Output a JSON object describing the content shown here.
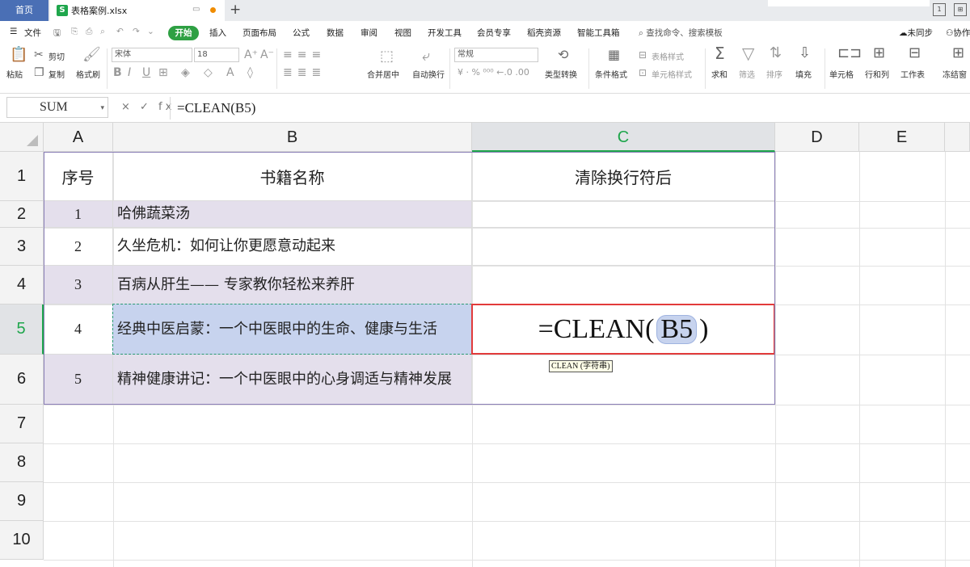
{
  "titlebar": {
    "home_tab": "首页",
    "file_tab": "表格案例.xlsx",
    "file_icon_letter": "S",
    "add_tab": "+",
    "win_btn_1": "1",
    "win_btn_2": "⊞"
  },
  "menu": {
    "file": "文件",
    "start": "开始",
    "items": [
      "插入",
      "页面布局",
      "公式",
      "数据",
      "审阅",
      "视图",
      "开发工具",
      "会员专享",
      "稻壳资源",
      "智能工具箱"
    ],
    "search": "查找命令、搜索模板",
    "unsynced": "未同步",
    "collab": "协作"
  },
  "toolbar": {
    "paste": "粘贴",
    "cut": "剪切",
    "copy": "复制",
    "format_painter": "格式刷",
    "font_name": "宋体",
    "font_size": "18",
    "merge_center": "合并居中",
    "wrap_text": "自动换行",
    "number_format": "常规",
    "type_convert": "类型转换",
    "conditional_format": "条件格式",
    "table_style": "表格样式",
    "cell_style": "单元格样式",
    "sum": "求和",
    "filter": "筛选",
    "sort": "排序",
    "fill": "填充",
    "cell": "单元格",
    "row_col": "行和列",
    "worksheet": "工作表",
    "freeze": "冻结窗"
  },
  "formula_bar": {
    "name_box": "SUM",
    "icons": "× ✓ fx",
    "formula": "=CLEAN(B5)"
  },
  "columns": [
    "A",
    "B",
    "C",
    "D",
    "E"
  ],
  "rows": [
    "1",
    "2",
    "3",
    "4",
    "5",
    "6",
    "7",
    "8",
    "9",
    "10"
  ],
  "table": {
    "headers": [
      "序号",
      "书籍名称",
      "清除换行符后"
    ],
    "data": [
      {
        "no": "1",
        "title": "哈佛蔬菜汤"
      },
      {
        "no": "2",
        "title": "久坐危机：如何让你更愿意动起来"
      },
      {
        "no": "3",
        "title": "百病从肝生—— 专家教你轻松来养肝"
      },
      {
        "no": "4",
        "title": "经典中医启蒙：一个中医眼中的生命、健康与生活"
      },
      {
        "no": "5",
        "title": "精神健康讲记：一个中医眼中的心身调适与精神发展"
      }
    ]
  },
  "editing": {
    "prefix": "=CLEAN(",
    "ref": "B5",
    "suffix": ")",
    "tooltip": "CLEAN (字符串)"
  },
  "colors": {
    "accent_green": "#1fa64c",
    "band_purple": "#e4dfec",
    "selection_blue": "#c7d3ee",
    "edit_border_red": "#e23b3b",
    "home_tab_blue": "#4a6fb5"
  }
}
